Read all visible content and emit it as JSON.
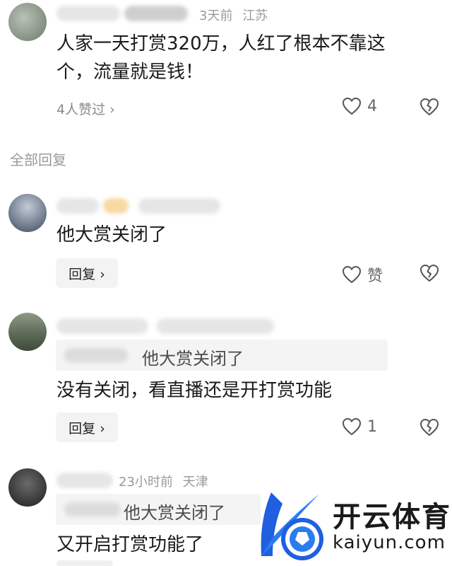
{
  "comments": [
    {
      "time": "3天前",
      "location": "江苏",
      "text_line1": "人家一天打赏320万，人红了根本不靠这",
      "text_line2": "个，流量就是钱！",
      "likes_link": "4人赞过 ›",
      "like_count": "4"
    }
  ],
  "section_title": "全部回复",
  "replies": [
    {
      "text": "他大赏关闭了",
      "reply_label": "回复 ›",
      "like_label": "赞"
    },
    {
      "quote": "他大赏关闭了",
      "text": "没有关闭，看直播还是开打赏功能",
      "reply_label": "回复 ›",
      "like_count": "1"
    },
    {
      "time": "23小时前",
      "location": "天津",
      "quote": "他大赏关闭了",
      "text": "又开启打赏功能了"
    }
  ],
  "watermark": {
    "brand": "开云体育",
    "url": "kaiyun.com",
    "colors": {
      "blue": "#1f5fe0",
      "dark": "#1a1a1a"
    }
  }
}
